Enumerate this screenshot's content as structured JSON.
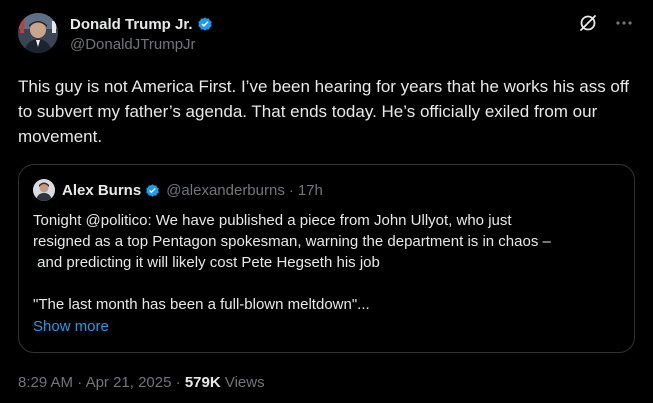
{
  "author": {
    "display_name": "Donald Trump Jr.",
    "handle": "@DonaldJTrumpJr",
    "verified": true,
    "avatar_icon": "profile-photo"
  },
  "header_icons": {
    "grok_icon": "grok-slash-circle-icon",
    "more_icon": "more-horizontal-icon"
  },
  "tweet_text": "This guy is not America First. I’ve been hearing for years that he works his ass off to subvert my father’s agenda. That ends today. He’s officially exiled from our movement.",
  "quoted": {
    "display_name": "Alex Burns",
    "handle": "@alexanderburns",
    "separator": "·",
    "time": "17h",
    "verified": true,
    "line1": "Tonight @politico: We have published a piece from John Ullyot, who just",
    "line2": "resigned as a top Pentagon spokesman, warning the department is in chaos –",
    "line3": " and predicting it will likely cost Pete Hegseth his job",
    "line4": "\"The last month has been a full-blown meltdown\"...",
    "show_more": "Show more"
  },
  "footer": {
    "time": "8:29 AM",
    "sep1": "·",
    "date": "Apr 21, 2025",
    "sep2": "·",
    "views_count": "579K",
    "views_label": "Views"
  },
  "colors": {
    "background": "#000000",
    "text": "#e7e9ea",
    "secondary": "#71767b",
    "accent": "#1d9bf0",
    "border": "#2f3336"
  }
}
